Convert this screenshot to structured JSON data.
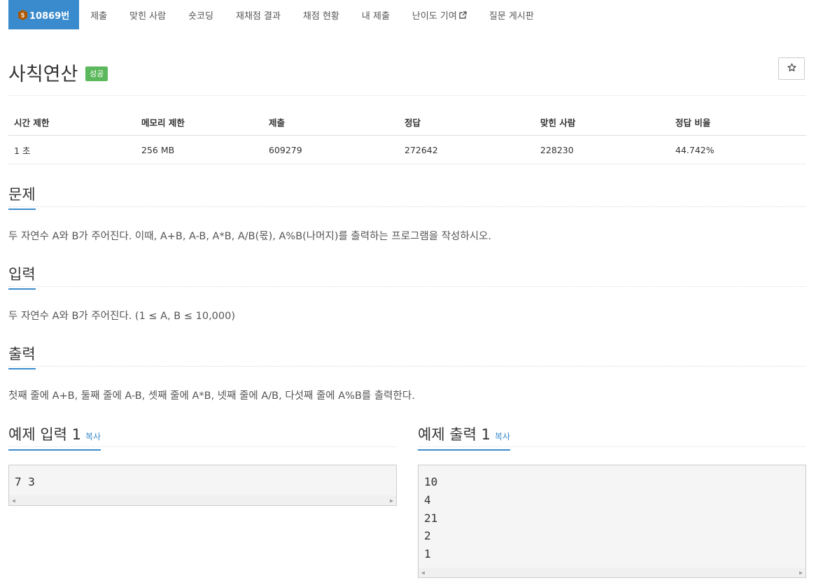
{
  "nav": {
    "problem_label": "10869번",
    "tier_number": "5",
    "items": [
      "제출",
      "맞힌 사람",
      "숏코딩",
      "재채점 결과",
      "채점 현황",
      "내 제출",
      "난이도 기여",
      "질문 게시판"
    ]
  },
  "problem": {
    "title": "사칙연산",
    "status_badge": "성공",
    "star_icon": "star-outline-icon"
  },
  "stats": {
    "headers": [
      "시간 제한",
      "메모리 제한",
      "제출",
      "정답",
      "맞힌 사람",
      "정답 비율"
    ],
    "values": [
      "1 초",
      "256 MB",
      "609279",
      "272642",
      "228230",
      "44.742%"
    ]
  },
  "sections": {
    "description": {
      "heading": "문제",
      "text": "두 자연수 A와 B가 주어진다. 이때, A+B, A-B, A*B, A/B(몫), A%B(나머지)를 출력하는 프로그램을 작성하시오."
    },
    "input": {
      "heading": "입력",
      "text": "두 자연수 A와 B가 주어진다. (1 ≤ A, B ≤ 10,000)"
    },
    "output": {
      "heading": "출력",
      "text": "첫째 줄에 A+B, 둘째 줄에 A-B, 셋째 줄에 A*B, 넷째 줄에 A/B, 다섯째 줄에 A%B를 출력한다."
    }
  },
  "samples": {
    "input": {
      "heading": "예제 입력 1",
      "copy_label": "복사",
      "content": "7 3"
    },
    "output": {
      "heading": "예제 출력 1",
      "copy_label": "복사",
      "content": "10\n4\n21\n2\n1"
    }
  },
  "colors": {
    "accent": "#3a8bcd",
    "success": "#5cb85c",
    "tier_bronze": "#ad5600"
  }
}
